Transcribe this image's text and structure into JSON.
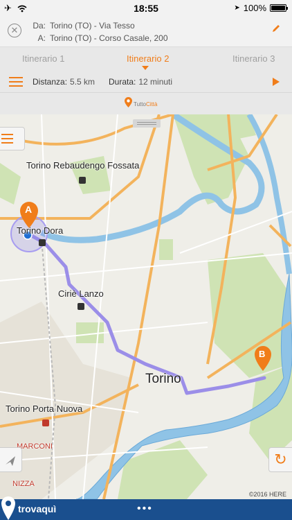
{
  "status_bar": {
    "time": "18:55",
    "battery": "100%"
  },
  "route": {
    "from_label": "Da:",
    "from_value": "Torino (TO) - Via Tesso",
    "to_label": "A:",
    "to_value": "Torino (TO) - Corso Casale, 200"
  },
  "tabs": [
    {
      "label": "Itinerario 1"
    },
    {
      "label": "Itinerario 2"
    },
    {
      "label": "Itinerario 3"
    }
  ],
  "active_tab": 1,
  "info": {
    "distance_label": "Distanza:",
    "distance_value": "5.5 km",
    "duration_label": "Durata:",
    "duration_value": "12 minuti"
  },
  "brand": {
    "part1": "Tutto",
    "part2": "Città"
  },
  "map": {
    "labels": {
      "rebaudengo": "Torino Rebaudengo Fossata",
      "dora": "Torino Dora",
      "cirie": "Ciriè Lanzo",
      "torino": "Torino",
      "porta_nuova": "Torino Porta Nuova",
      "marconi": "MARCONI",
      "nizza": "NIZZA"
    },
    "marker_a": "A",
    "marker_b": "B",
    "copyright": "©2016 HERE"
  },
  "footer": {
    "logo": "trovaquì",
    "more": "•••"
  },
  "colors": {
    "accent": "#f07d1a",
    "route": "#9b8ee8",
    "river": "#8fc3e6",
    "footer": "#1a4f8e"
  }
}
